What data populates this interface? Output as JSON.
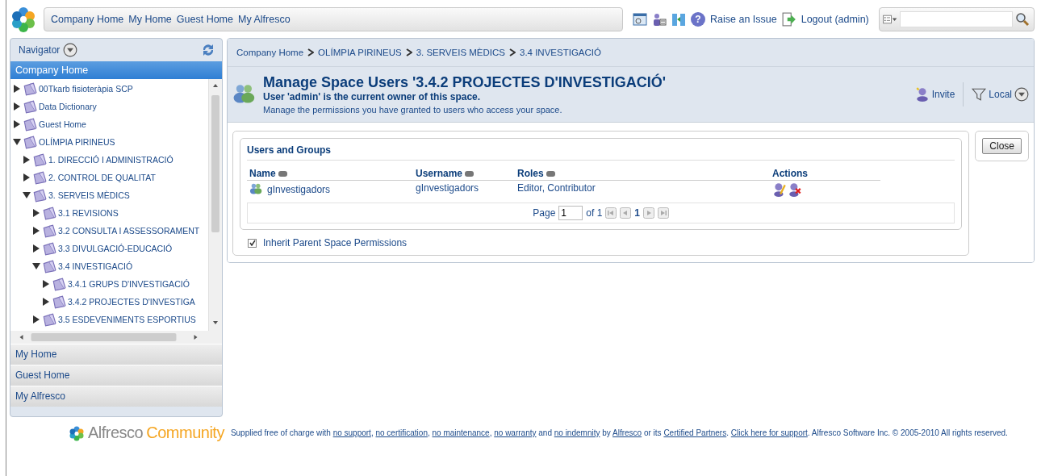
{
  "top_nav": {
    "links": [
      "Company Home",
      "My Home",
      "Guest Home",
      "My Alfresco"
    ],
    "help": "?",
    "raise_issue": "Raise an Issue",
    "logout": "Logout (admin)"
  },
  "navigator": {
    "title": "Navigator",
    "current": "Company Home",
    "tree": [
      {
        "label": "00Tkarb fisioteràpia SCP",
        "expanded": false
      },
      {
        "label": "Data Dictionary",
        "expanded": false
      },
      {
        "label": "Guest Home",
        "expanded": false
      },
      {
        "label": "OLÍMPIA PIRINEUS",
        "expanded": true,
        "children": [
          {
            "label": "1. DIRECCIÓ I ADMINISTRACIÓ",
            "expanded": false
          },
          {
            "label": "2. CONTROL DE QUALITAT",
            "expanded": false
          },
          {
            "label": "3. SERVEIS MÈDICS",
            "expanded": true,
            "children": [
              {
                "label": "3.1 REVISIONS",
                "expanded": false
              },
              {
                "label": "3.2 CONSULTA I ASSESSORAMENT",
                "expanded": false
              },
              {
                "label": "3.3 DIVULGACIÓ-EDUCACIÓ",
                "expanded": false
              },
              {
                "label": "3.4 INVESTIGACIÓ",
                "expanded": true,
                "children": [
                  {
                    "label": "3.4.1 GRUPS D'INVESTIGACIÓ",
                    "expanded": false
                  },
                  {
                    "label": "3.4.2 PROJECTES D'INVESTIGA",
                    "expanded": false
                  }
                ]
              },
              {
                "label": "3.5 ESDEVENIMENTS ESPORTIUS",
                "expanded": false
              }
            ]
          }
        ]
      }
    ],
    "panels": [
      "My Home",
      "Guest Home",
      "My Alfresco"
    ]
  },
  "breadcrumb": [
    "Company Home",
    "OLÍMPIA PIRINEUS",
    "3. SERVEIS MÈDICS",
    "3.4 INVESTIGACIÓ"
  ],
  "header": {
    "title": "Manage Space Users '3.4.2 PROJECTES D'INVESTIGACIÓ'",
    "owner": "User 'admin' is the current owner of this space.",
    "description": "Manage the permissions you have granted to users who access your space.",
    "invite": "Invite",
    "filter": "Local"
  },
  "users": {
    "title": "Users and Groups",
    "columns": [
      "Name",
      "Username",
      "Roles",
      "Actions"
    ],
    "rows": [
      {
        "name": "gInvestigadors",
        "username": "gInvestigadors",
        "roles": "Editor, Contributor"
      }
    ],
    "pager": {
      "label": "Page",
      "value": "1",
      "of": "of 1",
      "current": "1"
    }
  },
  "inherit": {
    "label": "Inherit Parent Space Permissions",
    "checked": true
  },
  "close": "Close",
  "footer": {
    "brand": "Alfresco",
    "edition": "Community",
    "segments": [
      {
        "text": "Supplied free of charge with ",
        "link": false
      },
      {
        "text": "no support",
        "link": true
      },
      {
        "text": ", ",
        "link": false
      },
      {
        "text": "no certification",
        "link": true
      },
      {
        "text": ", ",
        "link": false
      },
      {
        "text": "no maintenance",
        "link": true
      },
      {
        "text": ", ",
        "link": false
      },
      {
        "text": "no warranty",
        "link": true
      },
      {
        "text": " and ",
        "link": false
      },
      {
        "text": "no indemnity",
        "link": true
      },
      {
        "text": " by ",
        "link": false
      },
      {
        "text": "Alfresco",
        "link": true
      },
      {
        "text": " or its ",
        "link": false
      },
      {
        "text": "Certified Partners",
        "link": true
      },
      {
        "text": ". ",
        "link": false
      },
      {
        "text": "Click here for support",
        "link": true
      },
      {
        "text": ". Alfresco Software Inc. © 2005-2010 All rights reserved.",
        "link": false
      }
    ]
  }
}
